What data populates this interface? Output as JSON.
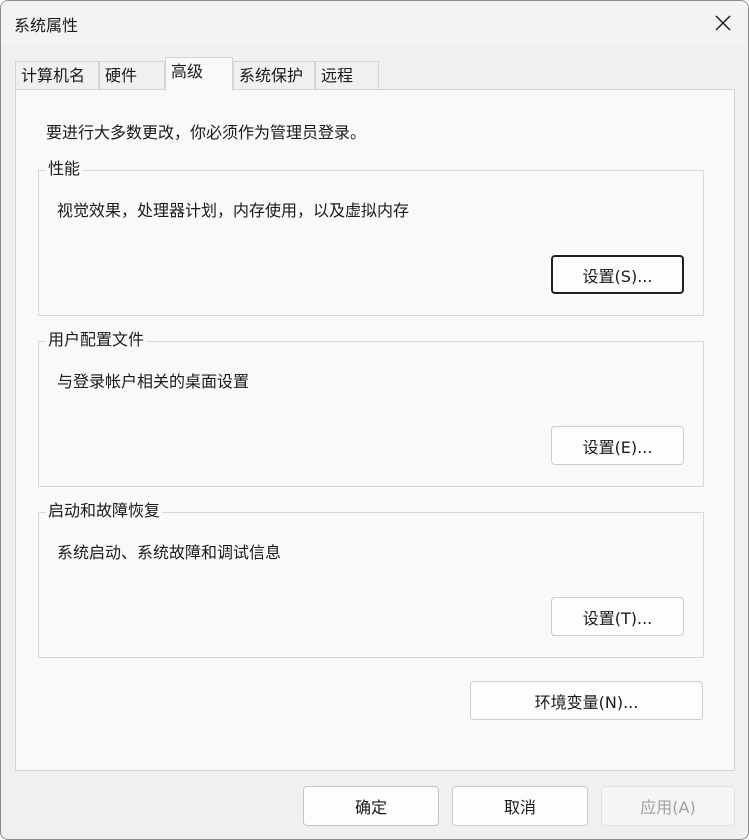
{
  "window": {
    "title": "系统属性"
  },
  "titlebar": {
    "close_icon": "close-icon"
  },
  "tabs": [
    {
      "label": "计算机名",
      "active": false
    },
    {
      "label": "硬件",
      "active": false
    },
    {
      "label": "高级",
      "active": true
    },
    {
      "label": "系统保护",
      "active": false
    },
    {
      "label": "远程",
      "active": false
    }
  ],
  "advanced": {
    "admin_note": "要进行大多数更改，你必须作为管理员登录。",
    "performance": {
      "label": "性能",
      "description": "视觉效果，处理器计划，内存使用，以及虚拟内存",
      "button": "设置(S)..."
    },
    "user_profiles": {
      "label": "用户配置文件",
      "description": "与登录帐户相关的桌面设置",
      "button": "设置(E)..."
    },
    "startup_recovery": {
      "label": "启动和故障恢复",
      "description": "系统启动、系统故障和调试信息",
      "button": "设置(T)..."
    },
    "env_button": "环境变量(N)..."
  },
  "footer": {
    "ok": "确定",
    "cancel": "取消",
    "apply": "应用(A)"
  },
  "colors": {
    "window_bg": "#f0f0f0",
    "panel_bg": "#f9f9f9",
    "disabled_text": "#a0a0a0"
  }
}
